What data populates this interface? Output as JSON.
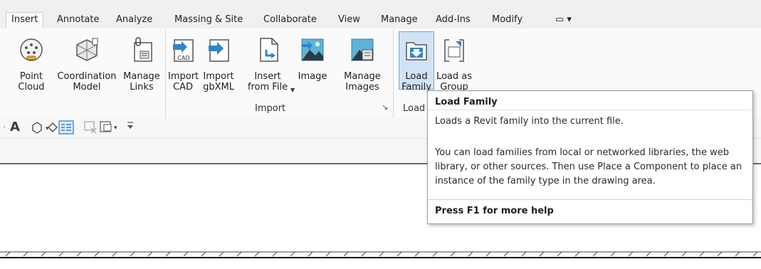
{
  "tabs": [
    "Insert",
    "Annotate",
    "Analyze",
    "Massing & Site",
    "Collaborate",
    "View",
    "Manage",
    "Add-Ins",
    "Modify"
  ],
  "tab_extra": "▭ ▾",
  "tools": {
    "point_cloud": "Point\nCloud",
    "coordination_model": "Coordination\nModel",
    "manage_links": "Manage\nLinks",
    "import_cad": "Import\nCAD",
    "import_gbxml": "Import\ngbXML",
    "insert_from_file": "Insert\nfrom File",
    "image": "Image",
    "manage_images": "Manage\nImages",
    "load_family": "Load\nFamily",
    "load_as_group": "Load as\nGroup"
  },
  "panels": {
    "import": "Import",
    "load_from": "Load fr",
    "launcher": "↘"
  },
  "qat": {
    "text_icon": "A"
  },
  "tooltip": {
    "title": "Load Family",
    "summary": "Loads a Revit family into the current file.",
    "details": [
      "You can load families from local or networked libraries, the web",
      "library, or other sources. Then use Place a Component to place an",
      "instance of the family type in the drawing area."
    ],
    "help": "Press F1 for more help"
  },
  "colors": {
    "highlight": "#cfe3f5",
    "highlight_border": "#74a8d6",
    "icon_blue": "#2e86c9"
  }
}
